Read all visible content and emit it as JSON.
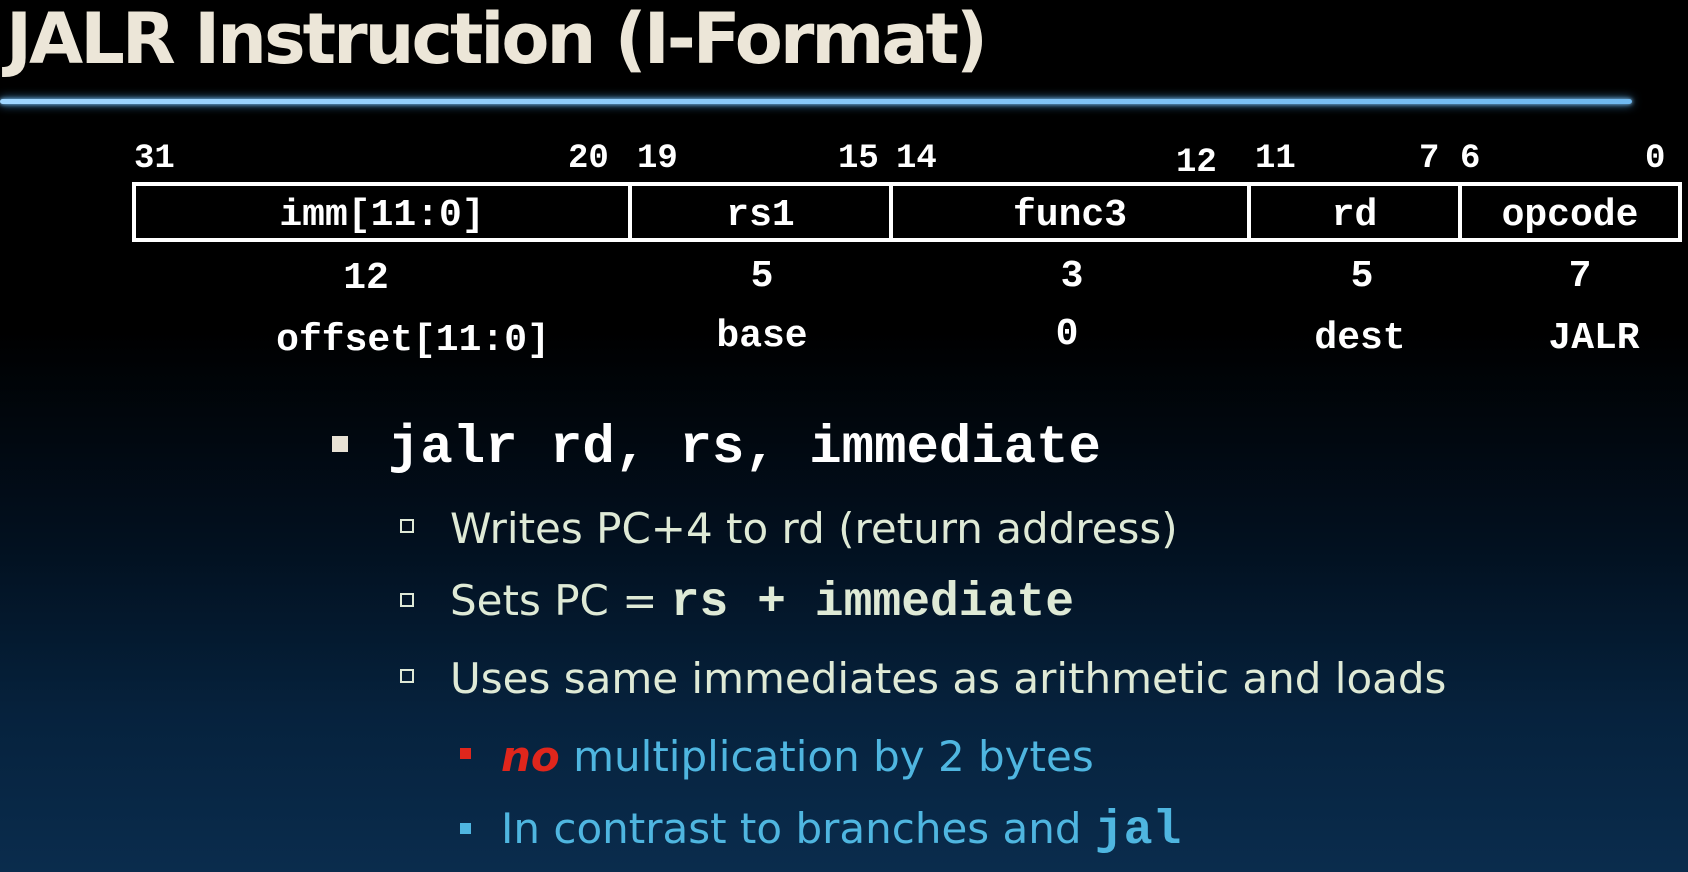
{
  "slide": {
    "title": "JALR Instruction (I-Format)"
  },
  "format": {
    "bit_positions": [
      "31",
      "20",
      "19",
      "15",
      "14",
      "12",
      "11",
      "7",
      "6",
      "0"
    ],
    "fields": [
      {
        "name": "imm[11:0]",
        "width": "12",
        "meaning": "offset[11:0]"
      },
      {
        "name": "rs1",
        "width": "5",
        "meaning": "base"
      },
      {
        "name": "func3",
        "width": "3",
        "meaning": "0"
      },
      {
        "name": "rd",
        "width": "5",
        "meaning": "dest"
      },
      {
        "name": "opcode",
        "width": "7",
        "meaning": "JALR"
      }
    ]
  },
  "bullets": {
    "main": "jalr rd, rs, immediate",
    "sub1": "Writes PC+4 to rd (return address)",
    "sub2_prefix": "Sets PC = ",
    "sub2_code": "rs + immediate",
    "sub3": "Uses same immediates as arithmetic and loads",
    "sub3a_emph": "no",
    "sub3a_rest": " multiplication by 2 bytes",
    "sub3b_prefix": "In contrast to branches and ",
    "sub3b_code": "jal"
  },
  "colors": {
    "title": "#ece6d8",
    "rule": "#9fd6ff",
    "body_text": "#dfead6",
    "sub_text": "#4fb6e0",
    "emphasis": "#e0261c"
  }
}
